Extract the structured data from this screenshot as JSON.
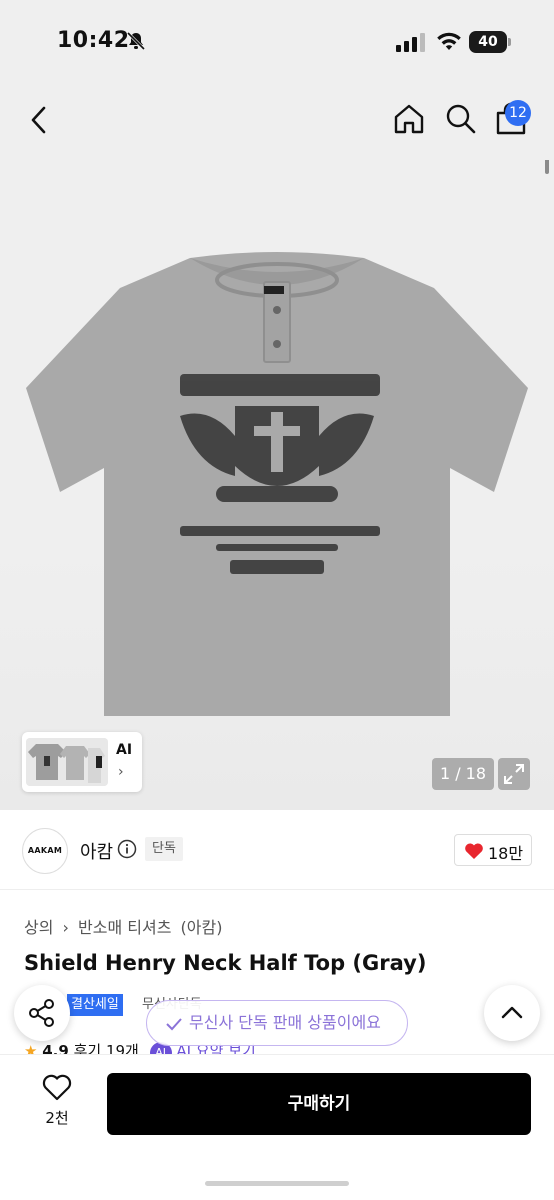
{
  "status_bar": {
    "time": "10:42",
    "battery": "40"
  },
  "nav": {
    "cart_count": "12"
  },
  "gallery": {
    "ai_label": "AI",
    "ai_chevron": "›",
    "pager": "1 / 18"
  },
  "brand": {
    "logo_text": "AAKAM",
    "name": "아캄",
    "exclusive_tag": "단독",
    "likes": "18만"
  },
  "product": {
    "breadcrumb": [
      "상의",
      "›",
      "반소매 티셔츠",
      "(아캄)"
    ],
    "title": "Shield Henry Neck Half Top (Gray)",
    "badges": {
      "blue": "결산세일",
      "gray": "무신사단독"
    },
    "rating": {
      "star": "★",
      "score": "4.9",
      "reviews": "후기 19개",
      "ai_label": "AI",
      "ai_text": "AI 요약 보기"
    }
  },
  "toast": {
    "text": "무신사 단독 판매 상품이에요"
  },
  "bottom": {
    "wish_count": "2천",
    "buy_label": "구매하기"
  },
  "colors": {
    "accent_blue": "#2f6ef2",
    "like_red": "#e8262e",
    "toast_purple": "#8b73d8",
    "buy_black": "#000000"
  },
  "icons": [
    "back-icon",
    "home-icon",
    "search-icon",
    "bag-icon",
    "share-icon",
    "chevron-up-icon",
    "heart-icon",
    "info-icon",
    "expand-icon"
  ]
}
